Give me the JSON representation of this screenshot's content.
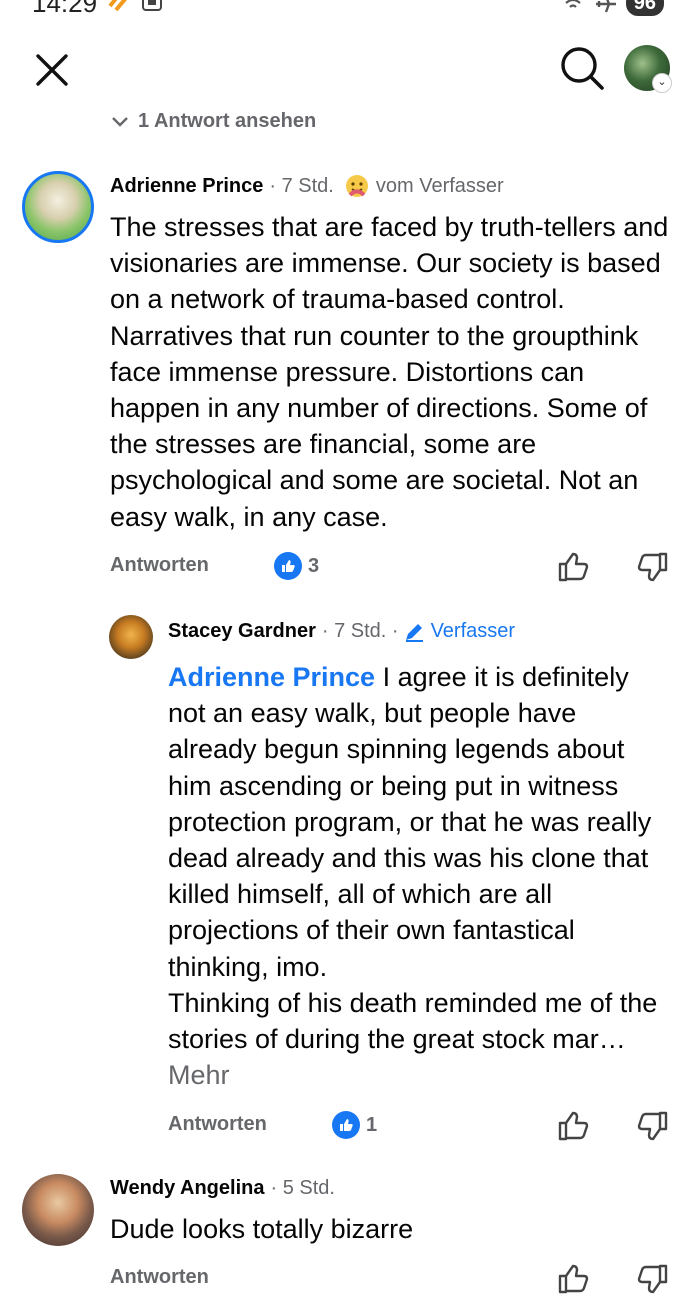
{
  "status": {
    "time": "14:29",
    "battery": "96"
  },
  "header": {
    "see_replies": "1 Antwort ansehen"
  },
  "comments": [
    {
      "name": "Adrienne Prince",
      "time": "7 Std.",
      "badge": "vom Verfasser",
      "text": "The stresses that are faced by truth-tellers and visionaries are immense. Our society is based on a network of trauma-based control. Narratives that run counter to the groupthink face immense pressure. Distortions can happen in any number of directions. Some of the stresses are financial, some are psychological and some are societal. Not an easy walk, in any case.",
      "reply_label": "Antworten",
      "reactions": "3"
    },
    {
      "name": "Stacey Gardner",
      "time": "7 Std.",
      "badge": "Verfasser",
      "mention": "Adrienne Prince",
      "text": " I agree it is definitely not an easy walk, but people have already begun spinning legends about him ascending or being put in witness protection program, or that he was really dead already and this was his clone that killed himself, all of which are all projections of their own fantastical thinking, imo.",
      "text2": "Thinking of his death reminded me of the stories of during the great stock mar…",
      "more": "Mehr",
      "reply_label": "Antworten",
      "reactions": "1"
    },
    {
      "name": "Wendy Angelina",
      "time": "5 Std.",
      "text": "Dude looks totally bizarre",
      "reply_label": "Antworten"
    }
  ],
  "colors": {
    "accent": "#1877f2",
    "secondary_text": "#65676b",
    "text": "#050505"
  }
}
